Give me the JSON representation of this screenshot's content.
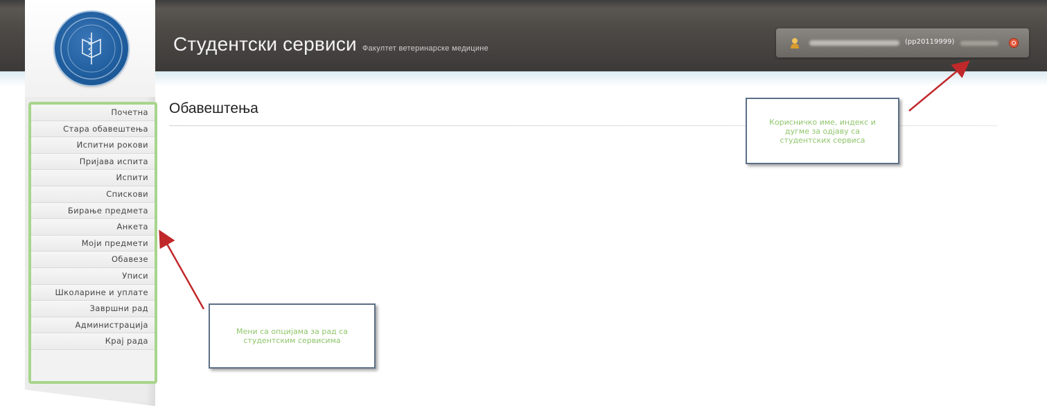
{
  "header": {
    "title": "Студентски сервиси",
    "subtitle": "Факултет ветеринарске медицине"
  },
  "user": {
    "index": "(pp20119999)"
  },
  "sidebar": {
    "items": [
      {
        "label": "Почетна"
      },
      {
        "label": "Стара обавештења"
      },
      {
        "label": "Испитни рокови"
      },
      {
        "label": "Пријава испита"
      },
      {
        "label": "Испити"
      },
      {
        "label": "Спискови"
      },
      {
        "label": "Бирање предмета"
      },
      {
        "label": "Анкета"
      },
      {
        "label": "Моји предмети"
      },
      {
        "label": "Обавезе"
      },
      {
        "label": "Уписи"
      },
      {
        "label": "Школарине и уплате"
      },
      {
        "label": "Завршни рад"
      },
      {
        "label": "Администрација"
      },
      {
        "label": "Крај рада"
      }
    ]
  },
  "main": {
    "title": "Обавештења"
  },
  "annotations": {
    "user_callout": "Корисничко име, индекс и дугме за одјаву са студентских сервиса",
    "menu_callout": "Мени са опцијама за рад са студентским сервисима"
  },
  "colors": {
    "menu_border": "#a8d58c",
    "callout_text": "#8fc56b",
    "callout_border": "#5b6f86",
    "arrow": "#c0282a",
    "header_bg": "#4d4a46"
  },
  "icons": {
    "logo": "faculty-seal-icon",
    "user": "user-icon",
    "logout": "logout-icon"
  }
}
